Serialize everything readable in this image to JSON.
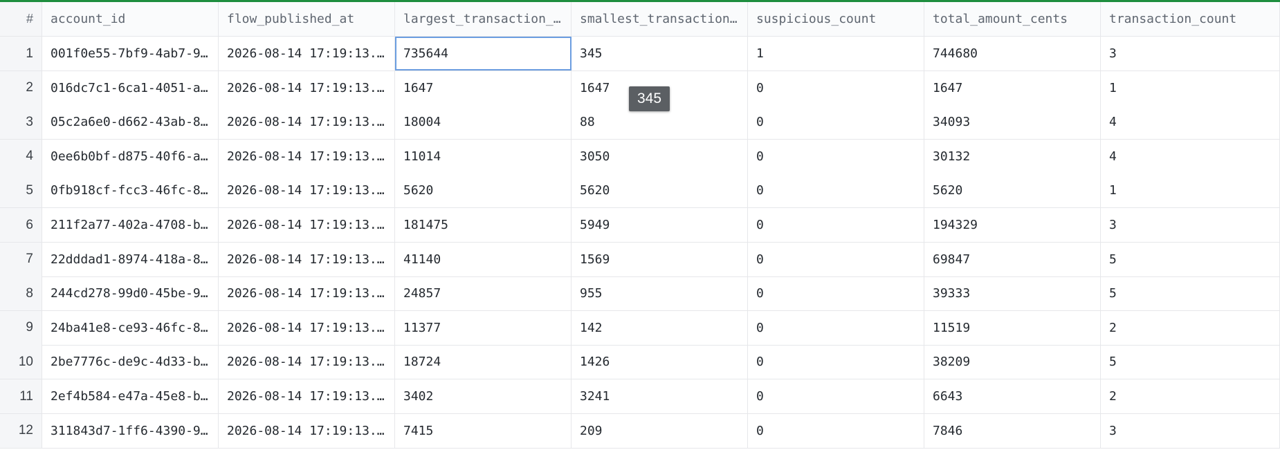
{
  "header": {
    "index_label": "#",
    "columns": [
      "account_id",
      "flow_published_at",
      "largest_transaction_…",
      "smallest_transaction…",
      "suspicious_count",
      "total_amount_cents",
      "transaction_count"
    ]
  },
  "rows": [
    {
      "index": "1",
      "cells": [
        "001f0e55-7bf9-4ab7-9…",
        "2026-08-14 17:19:13.…",
        "735644",
        "345",
        "1",
        "744680",
        "3"
      ]
    },
    {
      "index": "2",
      "cells": [
        "016dc7c1-6ca1-4051-a…",
        "2026-08-14 17:19:13.…",
        "1647",
        "1647",
        "0",
        "1647",
        "1"
      ]
    },
    {
      "index": "3",
      "cells": [
        "05c2a6e0-d662-43ab-8…",
        "2026-08-14 17:19:13.…",
        "18004",
        "88",
        "0",
        "34093",
        "4"
      ]
    },
    {
      "index": "4",
      "cells": [
        "0ee6b0bf-d875-40f6-a…",
        "2026-08-14 17:19:13.…",
        "11014",
        "3050",
        "0",
        "30132",
        "4"
      ]
    },
    {
      "index": "5",
      "cells": [
        "0fb918cf-fcc3-46fc-8…",
        "2026-08-14 17:19:13.…",
        "5620",
        "5620",
        "0",
        "5620",
        "1"
      ]
    },
    {
      "index": "6",
      "cells": [
        "211f2a77-402a-4708-b…",
        "2026-08-14 17:19:13.…",
        "181475",
        "5949",
        "0",
        "194329",
        "3"
      ]
    },
    {
      "index": "7",
      "cells": [
        "22dddad1-8974-418a-8…",
        "2026-08-14 17:19:13.…",
        "41140",
        "1569",
        "0",
        "69847",
        "5"
      ]
    },
    {
      "index": "8",
      "cells": [
        "244cd278-99d0-45be-9…",
        "2026-08-14 17:19:13.…",
        "24857",
        "955",
        "0",
        "39333",
        "5"
      ]
    },
    {
      "index": "9",
      "cells": [
        "24ba41e8-ce93-46fc-8…",
        "2026-08-14 17:19:13.…",
        "11377",
        "142",
        "0",
        "11519",
        "2"
      ]
    },
    {
      "index": "10",
      "cells": [
        "2be7776c-de9c-4d33-b…",
        "2026-08-14 17:19:13.…",
        "18724",
        "1426",
        "0",
        "38209",
        "5"
      ]
    },
    {
      "index": "11",
      "cells": [
        "2ef4b584-e47a-45e8-b…",
        "2026-08-14 17:19:13.…",
        "3402",
        "3241",
        "0",
        "6643",
        "2"
      ]
    },
    {
      "index": "12",
      "cells": [
        "311843d7-1ff6-4390-9…",
        "2026-08-14 17:19:13.…",
        "7415",
        "209",
        "0",
        "7846",
        "3"
      ]
    }
  ],
  "tooltip": {
    "text": "345"
  },
  "colors": {
    "accent": "#1e8e3e",
    "selection": "#6b9de0",
    "tooltip_bg": "#5b5f63"
  }
}
